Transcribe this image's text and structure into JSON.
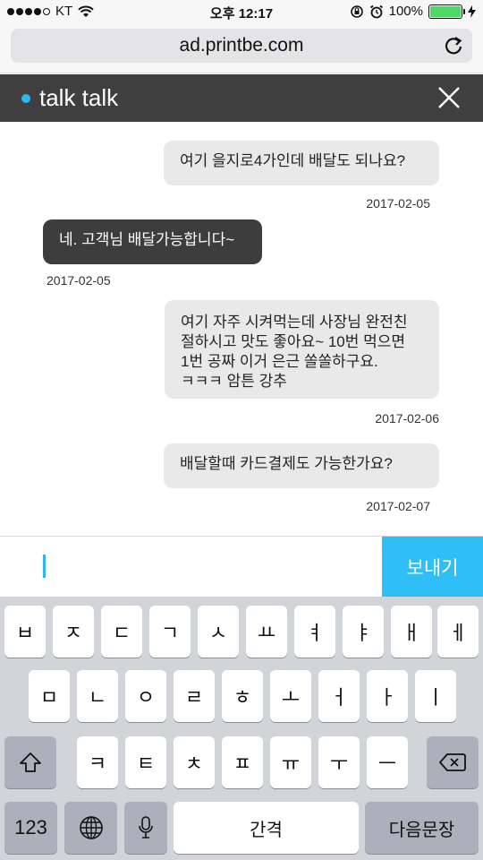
{
  "status_bar": {
    "carrier": "KT",
    "time": "오후 12:17",
    "battery_text": "100%",
    "battery_level": 1.0
  },
  "browser": {
    "url": "ad.printbe.com"
  },
  "header": {
    "title": "talk talk",
    "accent_color": "#2fb6f0"
  },
  "messages": [
    {
      "from": "me",
      "text": "여기 을지로4가인데 배달도 되나요?",
      "date": "2017-02-05"
    },
    {
      "from": "them",
      "text": "네. 고객님 배달가능합니다~",
      "date": "2017-02-05"
    },
    {
      "from": "me",
      "lines": [
        "여기 자주 시켜먹는데 사장님 완전친",
        "절하시고 맛도 좋아요~ 10번 먹으면",
        "1번 공짜 이거 은근 쏠쏠하구요.",
        "ㅋㅋㅋ 암튼 강추"
      ],
      "date": "2017-02-06"
    },
    {
      "from": "me",
      "text": "배달할때 카드결제도 가능한가요?",
      "date": "2017-02-07"
    }
  ],
  "composer": {
    "value": "",
    "send_label": "보내기",
    "send_color": "#2fbef5"
  },
  "keyboard": {
    "row1": [
      "ㅂ",
      "ㅈ",
      "ㄷ",
      "ㄱ",
      "ㅅ",
      "ㅛ",
      "ㅕ",
      "ㅑ",
      "ㅐ",
      "ㅔ"
    ],
    "row2": [
      "ㅁ",
      "ㄴ",
      "ㅇ",
      "ㄹ",
      "ㅎ",
      "ㅗ",
      "ㅓ",
      "ㅏ",
      "ㅣ"
    ],
    "row3": [
      "ㅋ",
      "ㅌ",
      "ㅊ",
      "ㅍ",
      "ㅠ",
      "ㅜ",
      "ㅡ"
    ],
    "numbers_label": "123",
    "space_label": "간격",
    "return_label": "다음문장",
    "shift_icon": "shift-icon",
    "delete_icon": "delete-icon",
    "globe_icon": "globe-icon",
    "mic_icon": "microphone-icon"
  }
}
